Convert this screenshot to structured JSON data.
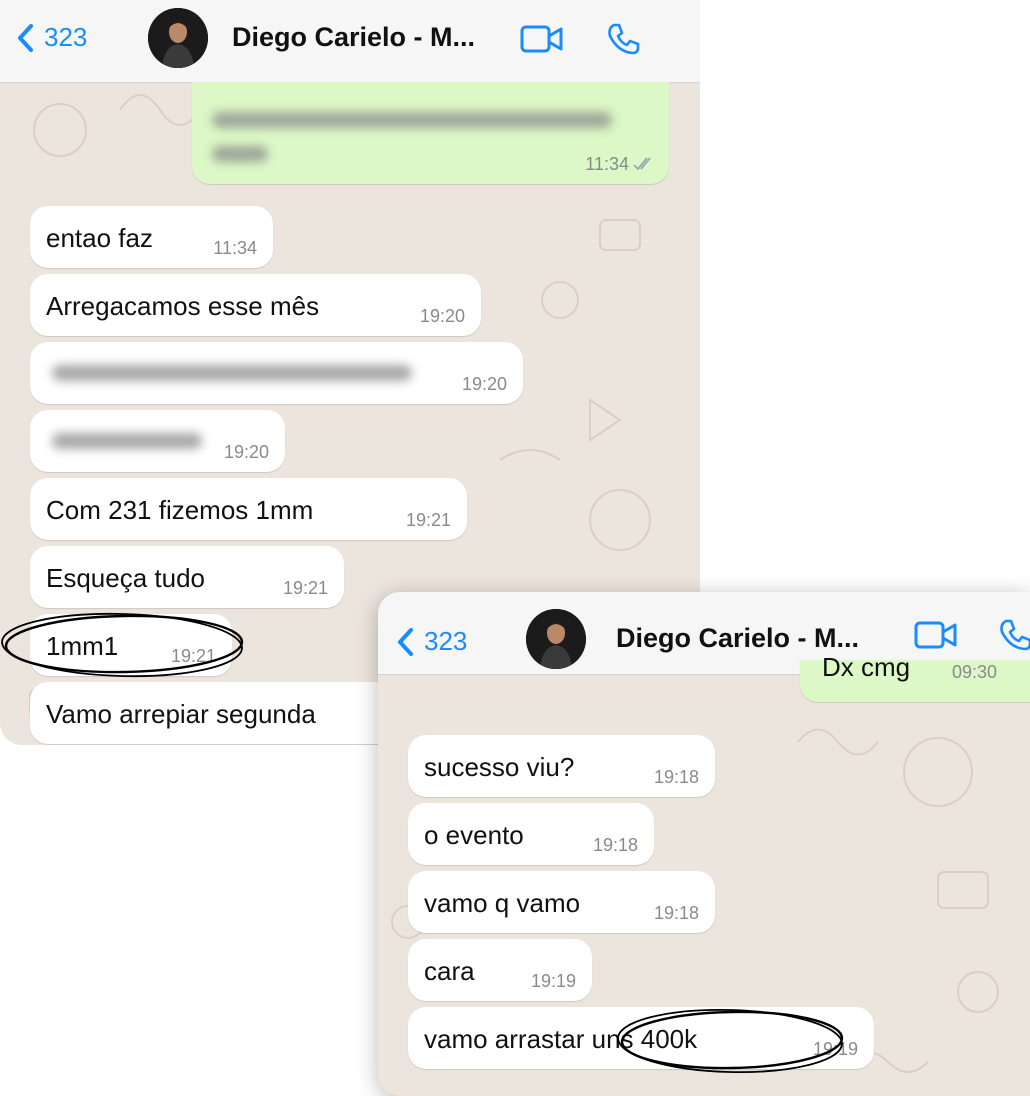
{
  "colors": {
    "accent": "#1a8cff",
    "chat_background": "#ece5dd",
    "incoming_bubble": "#ffffff",
    "outgoing_bubble": "#dcf8c6",
    "timestamp": "#8a8a8a",
    "annotation": "#000000"
  },
  "screenshots": [
    {
      "header": {
        "back_count": "323",
        "contact_name": "Diego Carielo - M...",
        "icons": [
          "chevron-left-icon",
          "avatar",
          "video-camera-icon",
          "phone-icon"
        ]
      },
      "messages": [
        {
          "direction": "outgoing",
          "text": "",
          "text_blurred": true,
          "time": "11:34",
          "read": true
        },
        {
          "direction": "incoming",
          "text": "entao faz",
          "time": "11:34"
        },
        {
          "direction": "incoming",
          "text": "Arregacamos esse mês",
          "time": "19:20"
        },
        {
          "direction": "incoming",
          "text": "",
          "text_blurred": true,
          "time": "19:20"
        },
        {
          "direction": "incoming",
          "text": "",
          "text_blurred": true,
          "time": "19:20"
        },
        {
          "direction": "incoming",
          "text": "Com 231 fizemos 1mm",
          "time": "19:21"
        },
        {
          "direction": "incoming",
          "text": "Esqueça tudo",
          "time": "19:21"
        },
        {
          "direction": "incoming",
          "text": "1mm1",
          "time": "19:21",
          "circled": true
        },
        {
          "direction": "incoming",
          "text": "Vamo arrepiar segunda",
          "time": ""
        }
      ]
    },
    {
      "header": {
        "back_count": "323",
        "contact_name": "Diego Carielo - M...",
        "icons": [
          "chevron-left-icon",
          "avatar",
          "video-camera-icon",
          "phone-icon"
        ]
      },
      "messages": [
        {
          "direction": "outgoing",
          "text": "Dx cmg",
          "time": "09:30",
          "read": true
        },
        {
          "direction": "incoming",
          "text": "sucesso viu?",
          "time": "19:18"
        },
        {
          "direction": "incoming",
          "text": "o evento",
          "time": "19:18"
        },
        {
          "direction": "incoming",
          "text": "vamo q vamo",
          "time": "19:18"
        },
        {
          "direction": "incoming",
          "text": "cara",
          "time": "19:19"
        },
        {
          "direction": "incoming",
          "text": "vamo arrastar uns 400k",
          "time": "19:19",
          "circled_fragment": "uns 400k"
        }
      ]
    }
  ]
}
